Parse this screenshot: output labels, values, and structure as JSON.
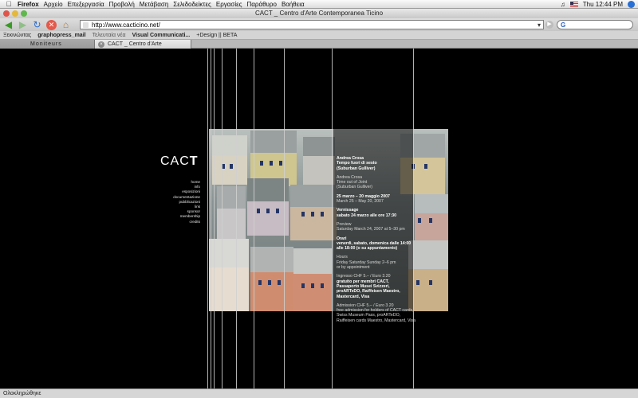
{
  "menubar": {
    "app": "Firefox",
    "items": [
      "Αρχείο",
      "Επεξεργασία",
      "Προβολή",
      "Μετάβαση",
      "Σελιδοδείκτες",
      "Εργασίες",
      "Παράθυρο",
      "Βοήθεια"
    ],
    "clock": "Thu 12:44 PM"
  },
  "window": {
    "title": "CACT _ Centro d'Arte Contemporanea Ticino"
  },
  "navbar": {
    "url": "http://www.cacticino.net/",
    "search_placeholder": "G"
  },
  "bookmarks": [
    "Ξεκινώντας",
    "graphopress_mail",
    "Τελευταία νέα",
    "Visual Communicati...",
    "+Design || BETA"
  ],
  "tabs": [
    {
      "label": "Moniteurs"
    },
    {
      "label": "CACT _ Centro d'Arte Contempor..."
    }
  ],
  "site": {
    "logo_main": "CAC",
    "logo_bold": "T",
    "nav": [
      "home",
      "info",
      "esposizioni",
      "documentazione",
      "pubblicazioni",
      "link",
      "sponsor",
      "membership",
      "credits"
    ],
    "panel": {
      "artist": "Andrea Crosa",
      "title_it": "Tempo fuori di sesto",
      "subtitle_it": "(Suburban Gulliver)",
      "artist_en": "Andrea Crosa",
      "title_en": "Time out of Joint",
      "subtitle_en": "(Suburban Gulliver)",
      "dates_it": "25 marzo – 20 maggio 2007",
      "dates_en": "March 25 – May 20, 2007",
      "vernissage_label": "Vernissage",
      "vernissage_date": "sabato 24 marzo alle ore 17:30",
      "preview_label": "Preview",
      "preview_date": "Saturday March 24, 2007 at 5–30 pm",
      "orari_label": "Orari",
      "orari_1": "venerdì, sabato, domenica dalle 14:00",
      "orari_2": "alle 18:00 (o su appuntamento)",
      "hours_label": "Hours",
      "hours_1": "Friday Saturday Sunday 2–6 pm",
      "hours_2": "or by appointment",
      "ingresso_1": "Ingresso CHF 5.– / Euro 3.20",
      "ingresso_2": "gratuito per membri CACT,",
      "ingresso_3": "Passaporto Musei Svizzeri,",
      "ingresso_4": "proARTeDO, Raiffeisen Maestro,",
      "ingresso_5": "Mastercard, Visa",
      "admission_1": "Admission CHF 5.– / Euro 3.20",
      "admission_2": "free admission for holders of CACT cards,",
      "admission_3": "Swiss Museum Pass, proARTeDO,",
      "admission_4": "Raiffeisen cards Maestro, Mastercard, Visa"
    }
  },
  "status": {
    "text": "Ολοκληρώθηκε"
  },
  "colors": {
    "background": "#000000",
    "panel_text": "#ffffff"
  }
}
